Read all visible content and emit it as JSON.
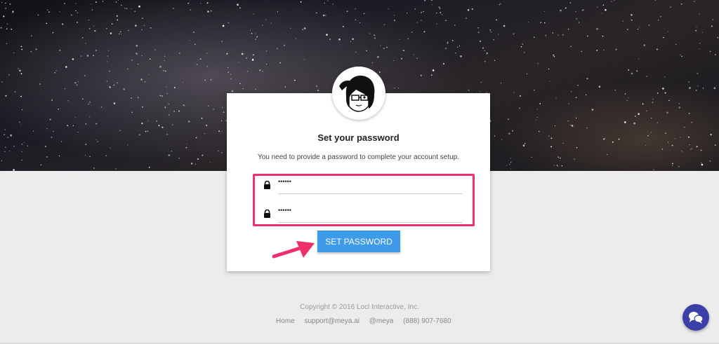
{
  "card": {
    "title": "Set your password",
    "description": "You need to provide a password to complete your account setup.",
    "password_value": "••••••",
    "confirm_value": "••••••",
    "button_label": "SET PASSWORD"
  },
  "footer": {
    "copyright": "Copyright © 2016 Locl Interactive, Inc.",
    "links": [
      "Home",
      "support@meya.ai",
      "@meya",
      "(888) 907-7680"
    ]
  },
  "icons": {
    "lock": "lock-icon",
    "chat": "chat-icon",
    "arrow": "arrow-icon"
  },
  "colors": {
    "button": "#3d9be9",
    "highlight": "#f0306b",
    "chat": "#3b3fa8"
  }
}
